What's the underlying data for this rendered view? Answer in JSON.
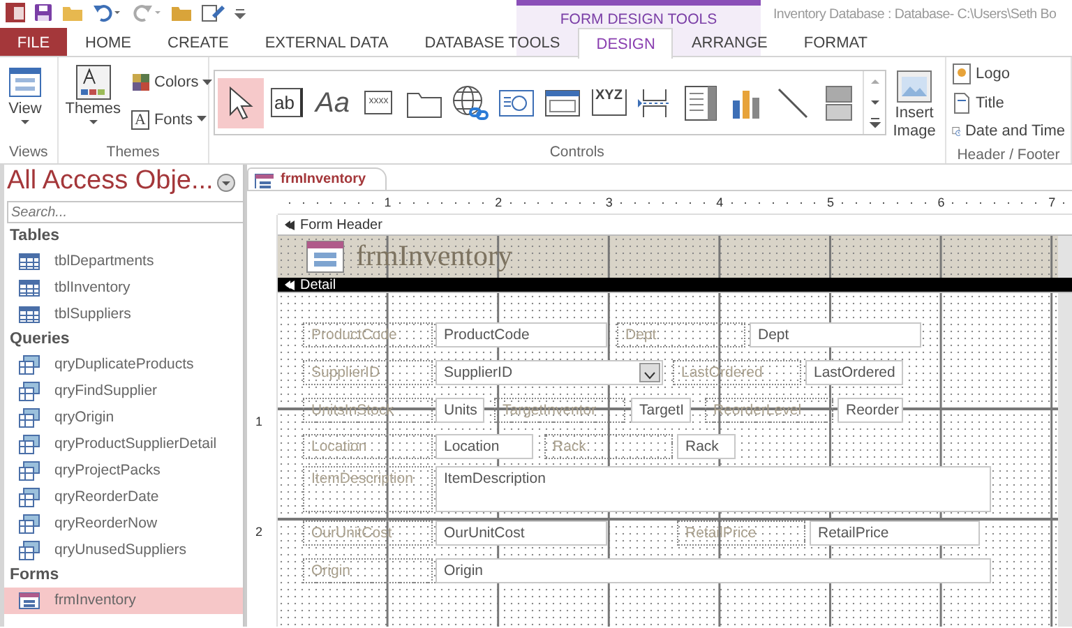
{
  "window": {
    "title": "Inventory Database : Database- C:\\Users\\Seth Bo"
  },
  "context_group": {
    "label": "FORM DESIGN TOOLS"
  },
  "ribbon_tabs": [
    {
      "label": "FILE",
      "kind": "file",
      "selected": false
    },
    {
      "label": "HOME",
      "kind": "normal",
      "selected": false
    },
    {
      "label": "CREATE",
      "kind": "normal",
      "selected": false
    },
    {
      "label": "EXTERNAL DATA",
      "kind": "normal",
      "selected": false
    },
    {
      "label": "DATABASE TOOLS",
      "kind": "normal",
      "selected": false
    },
    {
      "label": "DESIGN",
      "kind": "contextual",
      "selected": true
    },
    {
      "label": "ARRANGE",
      "kind": "contextual",
      "selected": false
    },
    {
      "label": "FORMAT",
      "kind": "contextual",
      "selected": false
    }
  ],
  "ribbon": {
    "views": {
      "button": "View",
      "group": "Views"
    },
    "themes": {
      "themes_button": "Themes",
      "colors": "Colors",
      "fonts": "Fonts",
      "font_glyph": "A",
      "group": "Themes"
    },
    "controls": {
      "group": "Controls",
      "insert_image": [
        "Insert",
        "Image"
      ],
      "gallery": [
        {
          "kind": "pointer",
          "selected": true
        },
        {
          "kind": "textbox",
          "glyph": "ab",
          "selected": false
        },
        {
          "kind": "label",
          "glyph": "Aa",
          "selected": false
        },
        {
          "kind": "button",
          "glyph": "xxxx",
          "selected": false
        },
        {
          "kind": "tab",
          "selected": false
        },
        {
          "kind": "hyperlink",
          "selected": false
        },
        {
          "kind": "browser",
          "selected": false
        },
        {
          "kind": "navigation",
          "selected": false
        },
        {
          "kind": "option_group",
          "glyph": "XYZ",
          "selected": false
        },
        {
          "kind": "page_break",
          "selected": false
        },
        {
          "kind": "combo",
          "selected": false
        },
        {
          "kind": "chart",
          "selected": false
        },
        {
          "kind": "line",
          "selected": false
        },
        {
          "kind": "toggle",
          "selected": false
        }
      ]
    },
    "header_footer": {
      "items": [
        "Logo",
        "Title",
        "Date and Time"
      ],
      "group": "Header / Footer"
    }
  },
  "nav_pane": {
    "title": "All Access Obje...",
    "search": {
      "placeholder": "Search..."
    },
    "groups": [
      {
        "label": "Tables",
        "kind": "table",
        "items": [
          {
            "label": "tblDepartments",
            "selected": false
          },
          {
            "label": "tblInventory",
            "selected": false
          },
          {
            "label": "tblSuppliers",
            "selected": false
          }
        ]
      },
      {
        "label": "Queries",
        "kind": "query",
        "items": [
          {
            "label": "qryDuplicateProducts",
            "selected": false
          },
          {
            "label": "qryFindSupplier",
            "selected": false
          },
          {
            "label": "qryOrigin",
            "selected": false
          },
          {
            "label": "qryProductSupplierDetail",
            "selected": false
          },
          {
            "label": "qryProjectPacks",
            "selected": false
          },
          {
            "label": "qryReorderDate",
            "selected": false
          },
          {
            "label": "qryReorderNow",
            "selected": false
          },
          {
            "label": "qryUnusedSuppliers",
            "selected": false
          }
        ]
      },
      {
        "label": "Forms",
        "kind": "form",
        "items": [
          {
            "label": "frmInventory",
            "selected": true
          }
        ]
      }
    ]
  },
  "document": {
    "tab": "frmInventory",
    "ruler": {
      "horizontal": [
        "1",
        "2",
        "3",
        "4",
        "5",
        "6",
        "7"
      ],
      "vertical": [
        "1",
        "2"
      ]
    },
    "form_header": {
      "bar": "Form Header",
      "title": "frmInventory"
    },
    "detail": {
      "bar": "Detail",
      "rows": [
        {
          "fields": [
            {
              "label": "ProductCode",
              "control": "ProductCode",
              "kind": "textbox"
            },
            {
              "label": "Dept",
              "control": "Dept",
              "kind": "textbox"
            }
          ]
        },
        {
          "fields": [
            {
              "label": "SupplierID",
              "control": "SupplierID",
              "kind": "combobox"
            },
            {
              "label": "LastOrdered",
              "control": "LastOrdered",
              "kind": "textbox"
            }
          ]
        },
        {
          "fields": [
            {
              "label": "UnitsInStock",
              "control": "Units",
              "kind": "textbox"
            },
            {
              "label": "TargetInventor",
              "control": "TargetI",
              "kind": "textbox"
            },
            {
              "label": "ReorderLevel",
              "control": "Reorder",
              "kind": "textbox"
            }
          ]
        },
        {
          "fields": [
            {
              "label": "Location",
              "control": "Location",
              "kind": "textbox"
            },
            {
              "label": "Rack",
              "control": "Rack",
              "kind": "textbox"
            }
          ]
        },
        {
          "fields": [
            {
              "label": "ItemDescription",
              "control": "ItemDescription",
              "kind": "textbox"
            }
          ]
        },
        {
          "fields": [
            {
              "label": "OurUnitCost",
              "control": "OurUnitCost",
              "kind": "textbox"
            },
            {
              "label": "RetailPrice",
              "control": "RetailPrice",
              "kind": "textbox"
            }
          ]
        },
        {
          "fields": [
            {
              "label": "Origin",
              "control": "Origin",
              "kind": "textbox"
            }
          ]
        }
      ]
    }
  }
}
